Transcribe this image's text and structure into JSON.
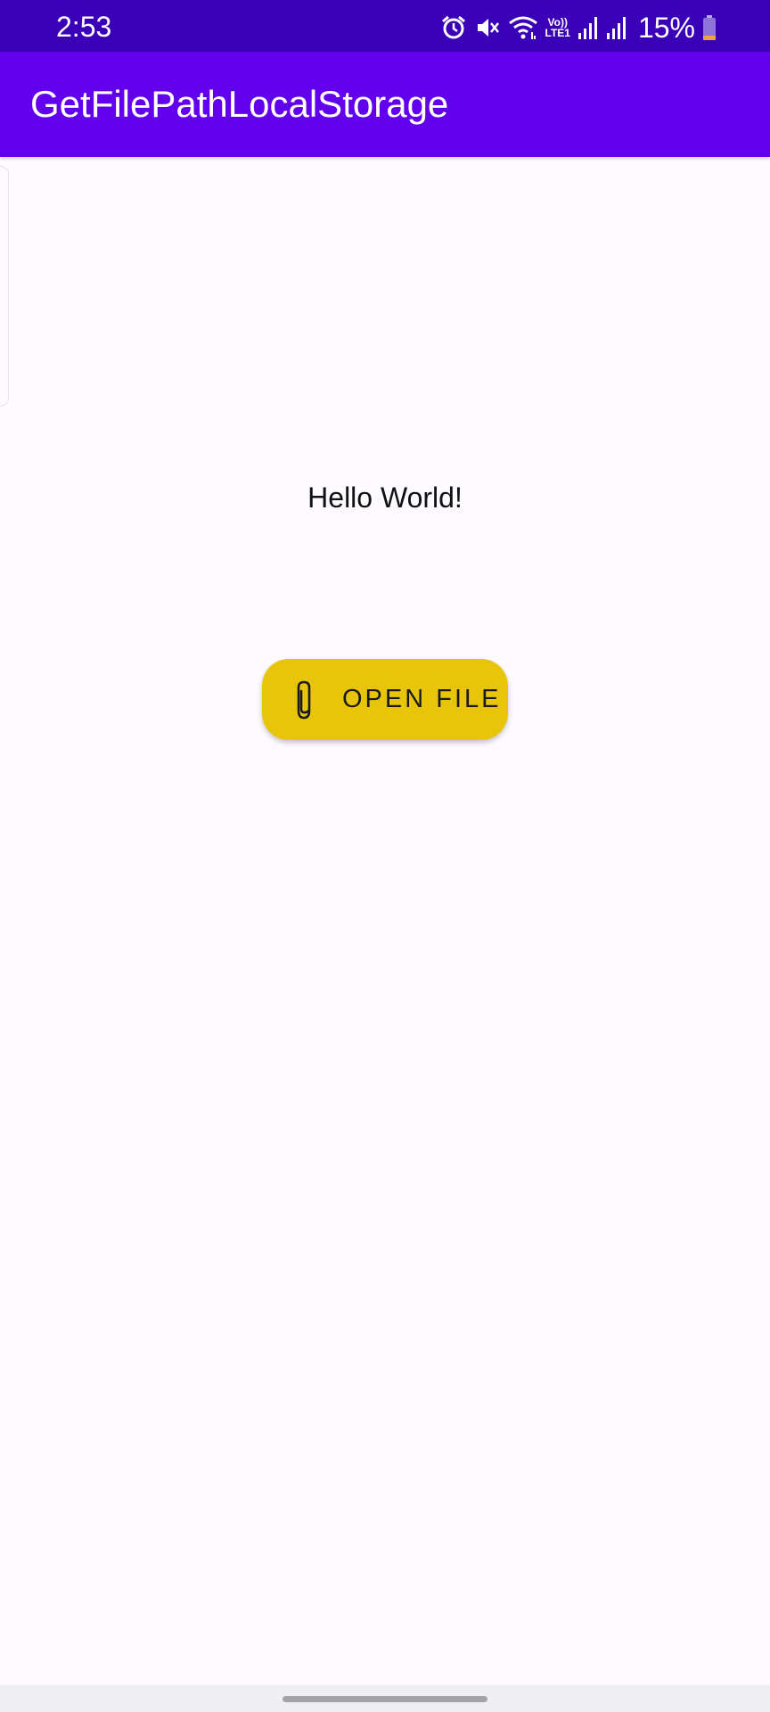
{
  "status_bar": {
    "time": "2:53",
    "network_label_top": "Vo))",
    "network_label_bottom": "LTE1",
    "battery": "15%",
    "icons": [
      "alarm-icon",
      "mute-icon",
      "wifi-icon",
      "signal-icon",
      "signal-icon",
      "battery-icon"
    ]
  },
  "app_bar": {
    "title": "GetFilePathLocalStorage"
  },
  "main": {
    "hello_text": "Hello World!",
    "open_file_button": {
      "label": "OPEN FILE",
      "icon": "paperclip-icon"
    }
  },
  "colors": {
    "status_bar": "#3a00b8",
    "app_bar": "#6200ee",
    "button": "#e8c50a",
    "background": "#fdfbff"
  }
}
